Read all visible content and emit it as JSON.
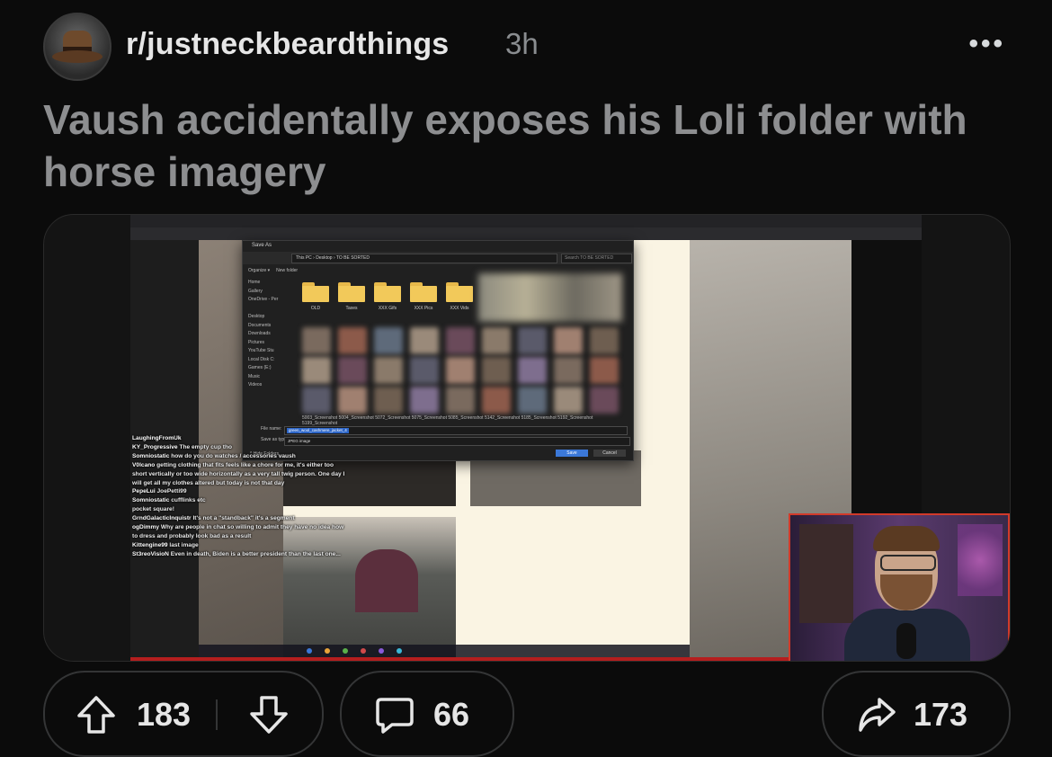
{
  "post": {
    "subreddit": "r/justneckbeardthings",
    "age": "3h",
    "more_label": "•••",
    "title": "Vaush accidentally exposes his Loli folder with horse imagery"
  },
  "dialog": {
    "title": "Save As",
    "path": "This PC › Desktop › TO BE SORTED",
    "search_placeholder": "Search TO BE SORTED",
    "organize": "Organize ▾",
    "new_folder": "New folder",
    "sidebar": [
      "Home",
      "Gallery",
      "OneDrive - Per",
      "",
      "Desktop",
      "Documents",
      "Downloads",
      "Pictures",
      "YouTube Stu",
      "Local Disk C:",
      "Games (E:)",
      "Music",
      "Videos"
    ],
    "folders": [
      "OLD",
      "Taxes",
      "XXX Gifs",
      "XXX Pics",
      "XXX Vids"
    ],
    "file_labels": [
      "5003_Screenshot",
      "5004_Screenshot",
      "5072_Screenshot",
      "5075_Screenshot",
      "5085_Screenshot",
      "5142_Screenshot",
      "5185_Screenshot",
      "5192_Screenshot",
      "5199_Screenshot"
    ],
    "file_name_label": "File name:",
    "file_name_value": "green_wool_cashmere_jacket_4",
    "save_type_label": "Save as type:",
    "save_type_value": "JPEG image",
    "hide_folders": "^ Hide Folders",
    "save_button": "Save",
    "cancel_button": "Cancel"
  },
  "chat": [
    {
      "user": "LaughingFromUk",
      "msg": ""
    },
    {
      "user": "KY_Progressive",
      "msg": "The empty cup tho"
    },
    {
      "user": "Somniostatic",
      "msg": "how do you do watches / accessories vaush"
    },
    {
      "user": "V0lcano",
      "msg": "getting clothing that fits feels like a chore for me, it's either too short vertically or too wide horizontally as a very tall twig person. One day I will get all my clothes altered but today is not that day"
    },
    {
      "user": "PepeLui",
      "msg": "JoePetti99"
    },
    {
      "user": "Somniostatic",
      "msg": "cufflinks etc"
    },
    {
      "user": "",
      "msg": "pocket square!"
    },
    {
      "user": "GrndGalacticInquistr",
      "msg": "It's not a \"standback\" it's a segment"
    },
    {
      "user": "ogDimmy",
      "msg": "Why are people in chat so willing to admit they have no idea how to dress and probably look bad as a result"
    },
    {
      "user": "Kittengine99",
      "msg": "last image"
    },
    {
      "user": "St3reoVisioN",
      "msg": "Even in death, Biden is a better president than the last one..."
    }
  ],
  "actions": {
    "upvotes": "183",
    "comments": "66",
    "shares": "173"
  },
  "colors": {
    "background": "#0b0b0b",
    "title": "#8d8e90",
    "pill_border": "#343536",
    "accent_folder": "#f2c95a"
  },
  "icons": [
    "avatar-hat-icon",
    "more-icon",
    "upvote-icon",
    "downvote-icon",
    "comment-icon",
    "share-icon"
  ]
}
